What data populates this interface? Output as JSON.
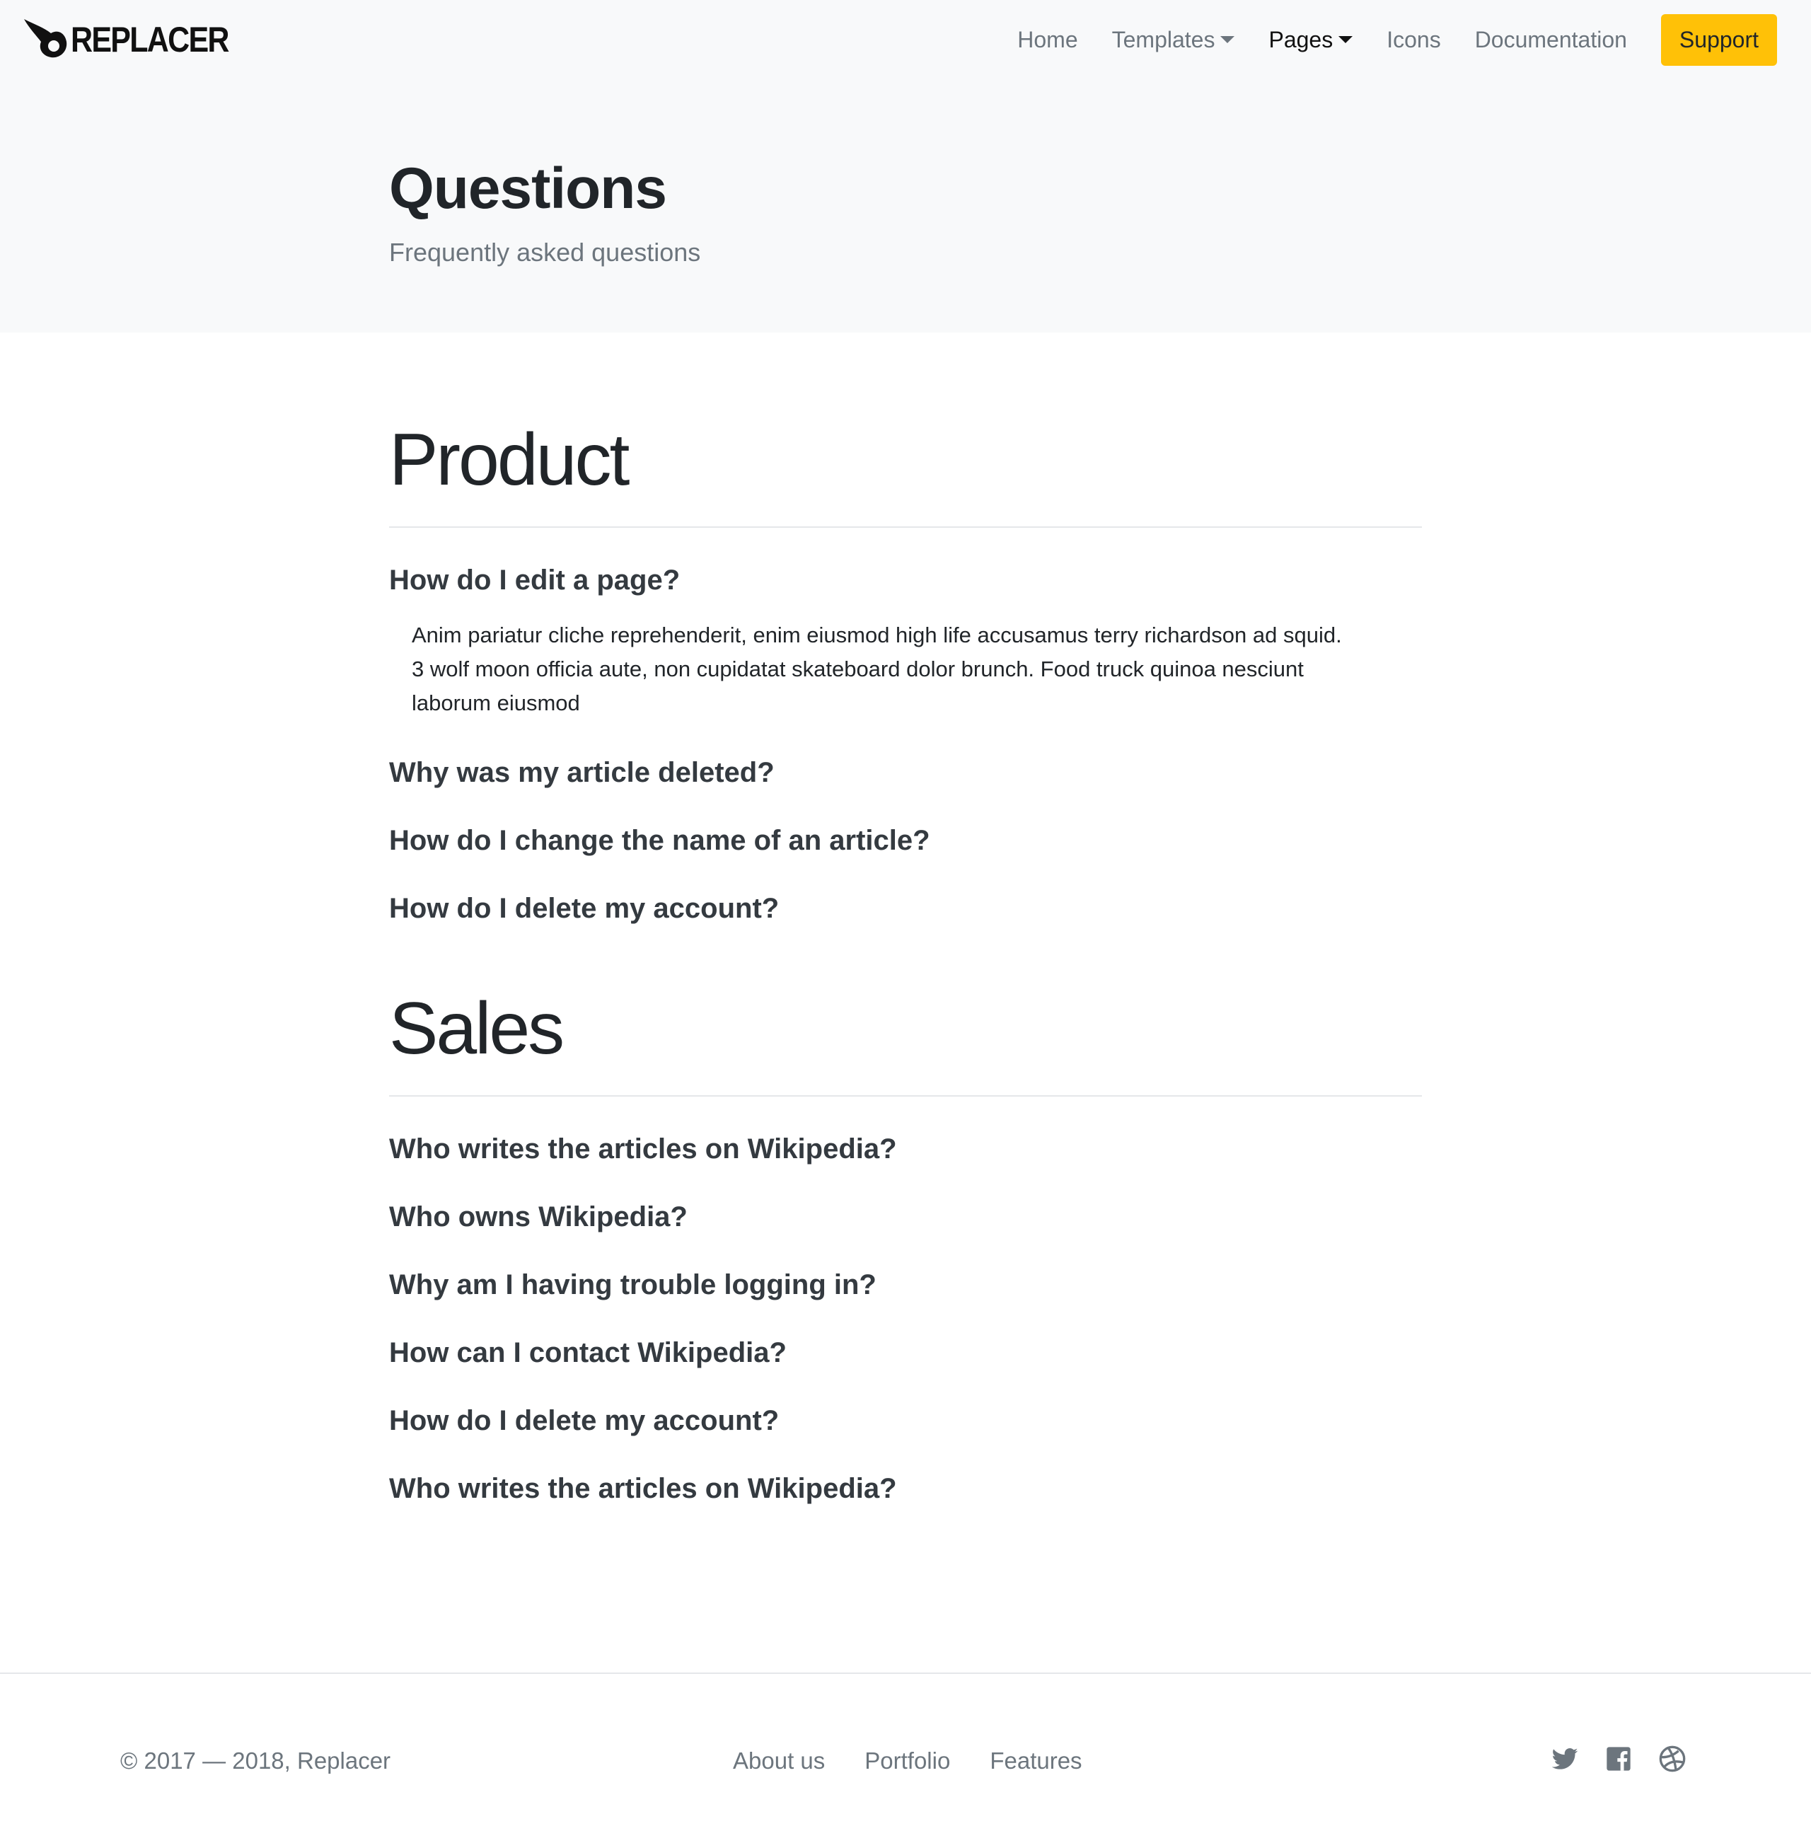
{
  "brand": {
    "name": "REPLACER"
  },
  "nav": {
    "items": [
      {
        "label": "Home",
        "has_caret": false
      },
      {
        "label": "Templates",
        "has_caret": true
      },
      {
        "label": "Pages",
        "has_caret": true,
        "active": true
      },
      {
        "label": "Icons",
        "has_caret": false
      },
      {
        "label": "Documentation",
        "has_caret": false
      }
    ],
    "support_label": "Support"
  },
  "hero": {
    "title": "Questions",
    "subtitle": "Frequently asked questions"
  },
  "sections": [
    {
      "title": "Product",
      "questions": [
        {
          "q": "How do I edit a page?",
          "answer": "Anim pariatur cliche reprehenderit, enim eiusmod high life accusamus terry richardson ad squid. 3 wolf moon officia aute, non cupidatat skateboard dolor brunch. Food truck quinoa nesciunt laborum eiusmod",
          "expanded": true
        },
        {
          "q": "Why was my article deleted?"
        },
        {
          "q": "How do I change the name of an article?"
        },
        {
          "q": "How do I delete my account?"
        }
      ]
    },
    {
      "title": "Sales",
      "questions": [
        {
          "q": "Who writes the articles on Wikipedia?"
        },
        {
          "q": "Who owns Wikipedia?"
        },
        {
          "q": "Why am I having trouble logging in?"
        },
        {
          "q": "How can I contact Wikipedia?"
        },
        {
          "q": "How do I delete my account?"
        },
        {
          "q": "Who writes the articles on Wikipedia?"
        }
      ]
    }
  ],
  "footer": {
    "copyright": "© 2017 — 2018, Replacer",
    "links": [
      "About us",
      "Portfolio",
      "Features"
    ],
    "social_icons": [
      "twitter-icon",
      "facebook-icon",
      "dribbble-icon"
    ]
  },
  "colors": {
    "accent": "#ffc107",
    "band_bg": "#f8f9fa",
    "muted": "#6c757d",
    "heading": "#343a40"
  }
}
